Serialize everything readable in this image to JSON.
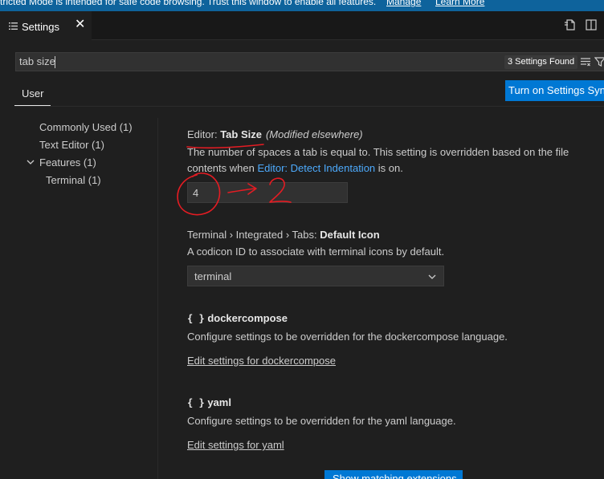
{
  "banner": {
    "message": "tricted Mode is intended for safe code browsing. Trust this window to enable all features.",
    "manage_label": "Manage",
    "learn_more_label": "Learn More"
  },
  "tab": {
    "title": "Settings",
    "close_symbol": "✕"
  },
  "search": {
    "value": "tab size",
    "results_badge": "3 Settings Found"
  },
  "scope": {
    "user_tab": "User",
    "sync_button": "Turn on Settings Sync"
  },
  "toc": {
    "items": [
      {
        "label": "Commonly Used (1)"
      },
      {
        "label": "Text Editor (1)"
      },
      {
        "label": "Features (1)"
      },
      {
        "label": "Terminal (1)"
      }
    ]
  },
  "settings": {
    "tab_size": {
      "category": "Editor: ",
      "name": "Tab Size",
      "modified": "(Modified elsewhere)",
      "desc_before": "The number of spaces a tab is equal to. This setting is overridden based on the file contents when ",
      "desc_link": "Editor: Detect Indentation",
      "desc_after": " is on.",
      "value": "4"
    },
    "terminal_icon": {
      "category": "Terminal › Integrated › Tabs: ",
      "name": "Default Icon",
      "desc": "A codicon ID to associate with terminal icons by default.",
      "value": "terminal"
    },
    "dockercompose": {
      "braces": "{ }",
      "name": "dockercompose",
      "desc": "Configure settings to be overridden for the dockercompose language.",
      "link": "Edit settings for dockercompose"
    },
    "yaml": {
      "braces": "{ }",
      "name": "yaml",
      "desc": "Configure settings to be overridden for the yaml language.",
      "link": "Edit settings for yaml"
    }
  },
  "bottom_button": "Show matching extensions",
  "annotation": {
    "text": "2",
    "color": "#e51c23"
  },
  "colors": {
    "accent": "#0078d4",
    "link": "#4daafc",
    "banner": "#0e639c"
  },
  "icons": {
    "tab": "settings-list-icon",
    "open_json": "open-settings-json-icon",
    "split": "split-editor-icon",
    "clear_filter": "clear-filter-icon",
    "filter": "filter-icon",
    "chevron": "chevron-down-icon"
  }
}
